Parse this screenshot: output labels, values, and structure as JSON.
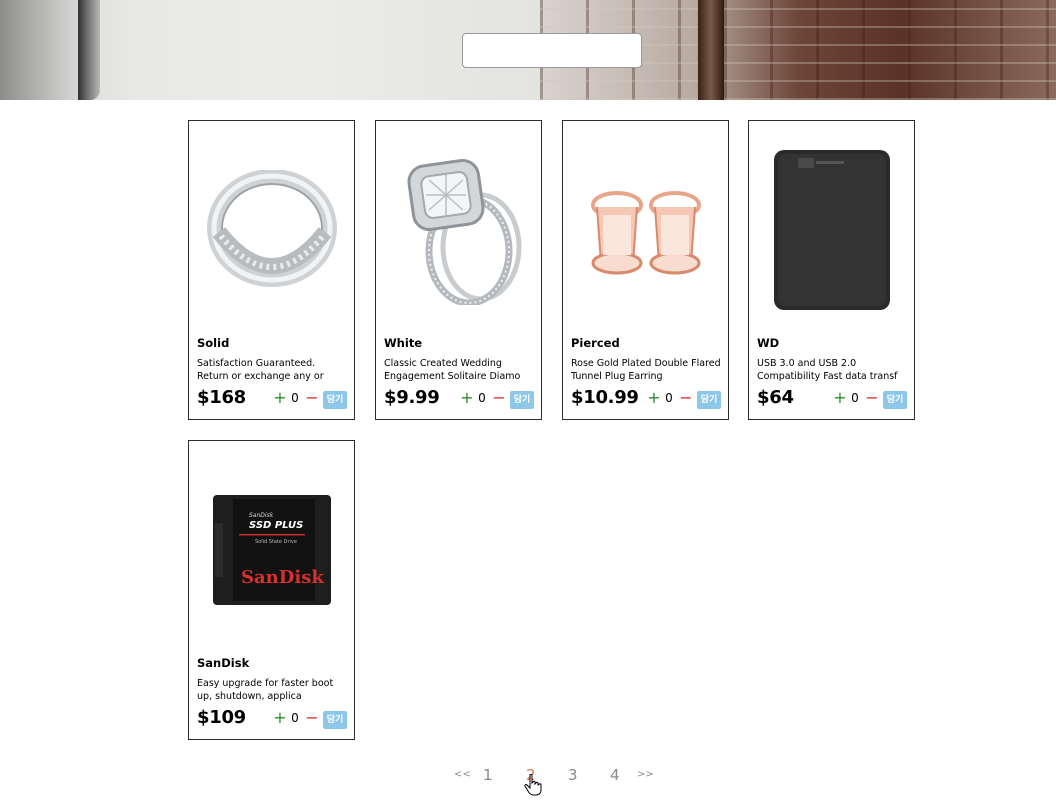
{
  "search": {
    "placeholder": "",
    "value": ""
  },
  "products": [
    {
      "name": "Solid",
      "description": "Satisfaction Guaranteed. Return or exchange any or",
      "price": "$168",
      "quantity": "0",
      "add_label": "담기",
      "image": "silver-ring-image"
    },
    {
      "name": "White",
      "description": "Classic Created Wedding Engagement Solitaire Diamo",
      "price": "$9.99",
      "quantity": "0",
      "add_label": "담기",
      "image": "diamond-ring-set-image"
    },
    {
      "name": "Pierced",
      "description": "Rose Gold Plated Double Flared Tunnel Plug Earring",
      "price": "$10.99",
      "quantity": "0",
      "add_label": "담기",
      "image": "rose-gold-plugs-image"
    },
    {
      "name": "WD",
      "description": "USB 3.0 and USB 2.0 Compatibility Fast data transf",
      "price": "$64",
      "quantity": "0",
      "add_label": "담기",
      "image": "external-hard-drive-image"
    },
    {
      "name": "SanDisk",
      "description": "Easy upgrade for faster boot up, shutdown, applica",
      "price": "$109",
      "quantity": "0",
      "add_label": "담기",
      "image": "ssd-drive-image"
    }
  ],
  "icons": {
    "plus": "+",
    "minus": "−"
  },
  "ssd_label": {
    "line1": "SanDisk",
    "line2": "SSD PLUS",
    "line3": "Solid State Drive",
    "brand": "SanDisk"
  },
  "pagination": {
    "prev": "<<",
    "pages": [
      "1",
      "2",
      "3",
      "4"
    ],
    "current": "2",
    "next": ">>"
  },
  "colors": {
    "plus": "#2e8b2e",
    "minus": "#d83030",
    "add_button": "#8ec8e8",
    "active_page": "#e07a4a"
  }
}
